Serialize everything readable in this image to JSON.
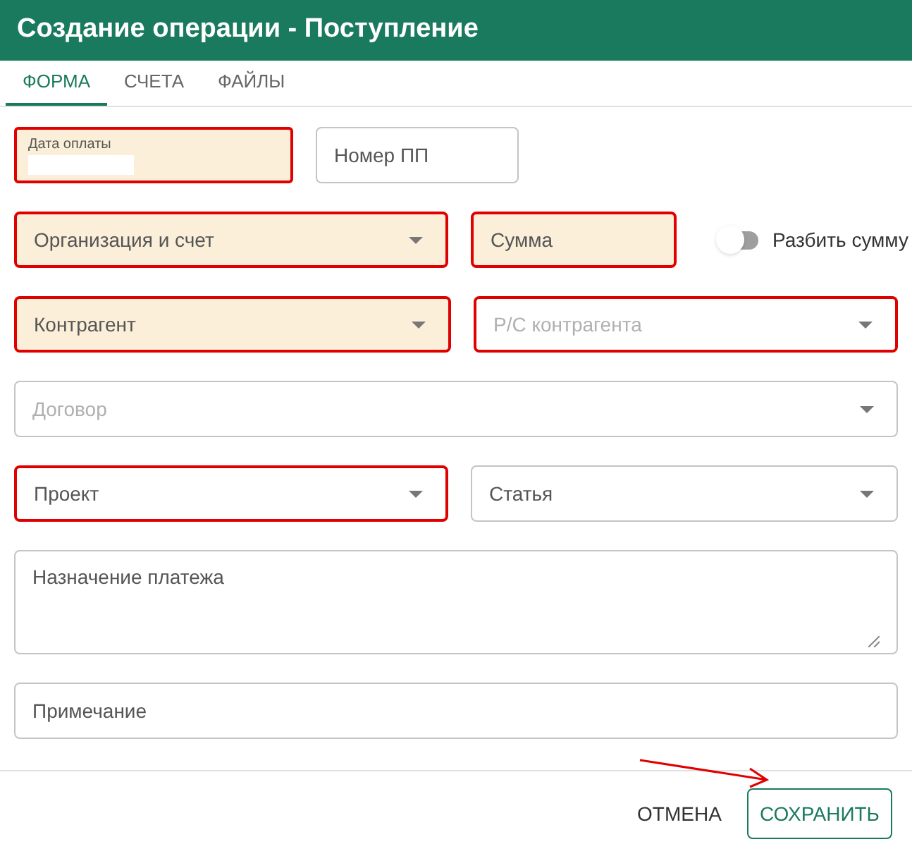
{
  "window": {
    "title": "Создание операции - Поступление"
  },
  "tabs": [
    {
      "label": "ФОРМА",
      "selected": true
    },
    {
      "label": "СЧЕТА",
      "selected": false
    },
    {
      "label": "ФАЙЛЫ",
      "selected": false
    }
  ],
  "rows": [
    [
      {
        "kind": "date",
        "label": "Дата оплаты",
        "required": true,
        "highlighted": true,
        "disabled": false
      },
      {
        "kind": "text",
        "label": "Номер ПП",
        "required": false,
        "highlighted": false,
        "disabled": false
      }
    ],
    [
      {
        "kind": "select",
        "label": "Организация и счет",
        "required": true,
        "highlighted": true,
        "disabled": false
      },
      {
        "kind": "text",
        "label": "Сумма",
        "required": true,
        "highlighted": true,
        "disabled": false
      },
      {
        "kind": "toggle",
        "label": "Разбить сумму",
        "on": false
      }
    ],
    [
      {
        "kind": "select",
        "label": "Контрагент",
        "required": true,
        "highlighted": true,
        "disabled": false
      },
      {
        "kind": "select",
        "label": "Р/С контрагента",
        "required": false,
        "highlighted": true,
        "disabled": true
      }
    ],
    [
      {
        "kind": "select",
        "label": "Договор",
        "required": false,
        "highlighted": false,
        "disabled": true
      }
    ],
    [
      {
        "kind": "select",
        "label": "Проект",
        "required": false,
        "highlighted": true,
        "disabled": false
      },
      {
        "kind": "select",
        "label": "Статья",
        "required": false,
        "highlighted": false,
        "disabled": false
      }
    ],
    [
      {
        "kind": "textarea",
        "label": "Назначение платежа",
        "required": false,
        "highlighted": false,
        "disabled": false
      }
    ],
    [
      {
        "kind": "text",
        "label": "Примечание",
        "required": false,
        "highlighted": false,
        "disabled": false
      }
    ]
  ],
  "buttons": [
    {
      "label": "ОТМЕНА",
      "kind": "text"
    },
    {
      "label": "СОХРАНИТЬ",
      "kind": "outlined"
    }
  ]
}
